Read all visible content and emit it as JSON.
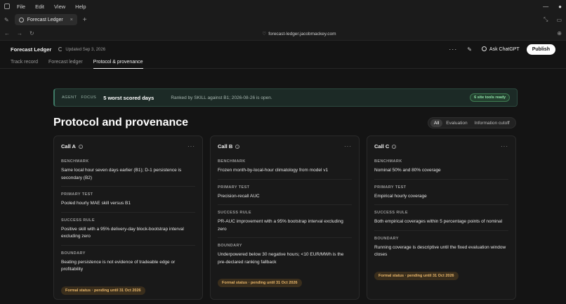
{
  "window": {
    "menu": [
      "File",
      "Edit",
      "View",
      "Help"
    ]
  },
  "browser": {
    "tab_title": "Forecast Ledger",
    "url": "forecast-ledger.jacobmackey.com"
  },
  "app": {
    "title": "Forecast Ledger",
    "updated": "Updated Sep 3, 2026",
    "ask_label": "Ask ChatGPT",
    "publish_label": "Publish",
    "tabs": [
      "Track record",
      "Forecast ledger",
      "Protocol & provenance"
    ],
    "active_tab": "Protocol & provenance"
  },
  "banner": {
    "tag_agent": "AGENT",
    "tag_focus": "FOCUS",
    "headline": "5 worst scored days",
    "subtitle": "Ranked by SKILL against B1; 2026-08-26 is open.",
    "status": "6 site tools ready"
  },
  "section": {
    "title": "Protocol and provenance",
    "filters": [
      "All",
      "Evaluation",
      "Information cutoff"
    ],
    "selected_filter": "All"
  },
  "labels": {
    "benchmark": "BENCHMARK",
    "primary_test": "PRIMARY TEST",
    "success_rule": "SUCCESS RULE",
    "boundary": "BOUNDARY"
  },
  "cards": [
    {
      "title": "Call A",
      "benchmark": "Same local hour seven days earlier (B1); D-1 persistence is secondary (B2)",
      "primary_test": "Pooled hourly MAE skill versus B1",
      "success_rule": "Positive skill with a 95% delivery-day block-bootstrap interval excluding zero",
      "boundary": "Beating persistence is not evidence of tradeable edge or profitability",
      "status": "Formal status · pending until 31 Oct 2026"
    },
    {
      "title": "Call B",
      "benchmark": "Frozen month-by-local-hour climatology from model v1",
      "primary_test": "Precision-recall AUC",
      "success_rule": "PR-AUC improvement with a 95% bootstrap interval excluding zero",
      "boundary": "Underpowered below 30 negative hours; <10 EUR/MWh is the pre-declared ranking fallback",
      "status": "Formal status · pending until 31 Oct 2026"
    },
    {
      "title": "Call C",
      "benchmark": "Nominal 50% and 80% coverage",
      "primary_test": "Empirical hourly coverage",
      "success_rule": "Both empirical coverages within 5 percentage points of nominal",
      "boundary": "Running coverage is descriptive until the fixed evaluation window closes",
      "status": "Formal status · pending until 31 Oct 2026"
    }
  ]
}
